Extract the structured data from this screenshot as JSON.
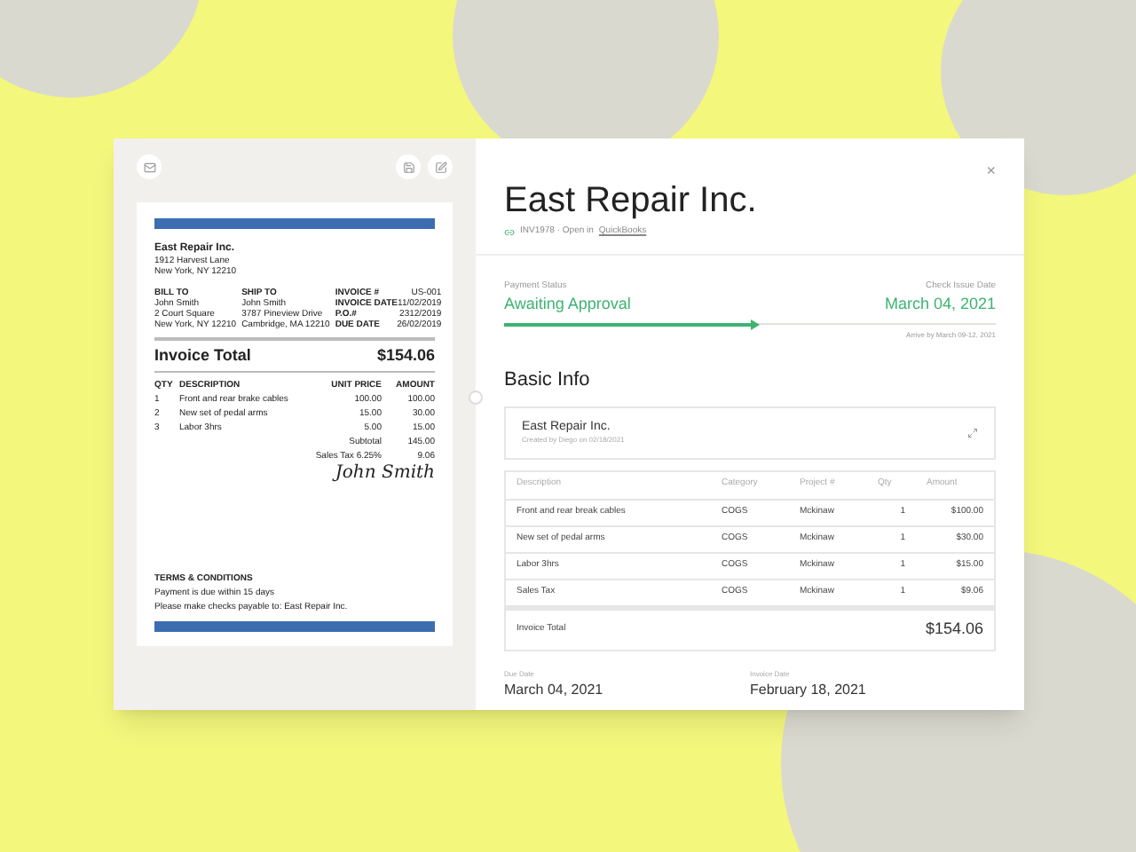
{
  "document": {
    "company": "East Repair Inc.",
    "address": [
      "1912 Harvest Lane",
      "New York, NY 12210"
    ],
    "bill_to": {
      "heading": "BILL TO",
      "lines": [
        "John Smith",
        "2 Court Square",
        "New York, NY 12210"
      ]
    },
    "ship_to": {
      "heading": "SHIP TO",
      "lines": [
        "John Smith",
        "3787 Pineview Drive",
        "Cambridge, MA 12210"
      ]
    },
    "meta": [
      {
        "label": "INVOICE #",
        "value": "US-001"
      },
      {
        "label": "INVOICE DATE",
        "value": "11/02/2019"
      },
      {
        "label": "P.O.#",
        "value": "2312/2019"
      },
      {
        "label": "DUE DATE",
        "value": "26/02/2019"
      }
    ],
    "total_label": "Invoice Total",
    "total": "$154.06",
    "columns": [
      "QTY",
      "DESCRIPTION",
      "UNIT PRICE",
      "AMOUNT"
    ],
    "items": [
      {
        "qty": "1",
        "description": "Front and rear brake cables",
        "unit_price": "100.00",
        "amount": "100.00"
      },
      {
        "qty": "2",
        "description": "New set of pedal arms",
        "unit_price": "15.00",
        "amount": "30.00"
      },
      {
        "qty": "3",
        "description": "Labor 3hrs",
        "unit_price": "5.00",
        "amount": "15.00"
      }
    ],
    "summary": [
      {
        "label": "Subtotal",
        "value": "145.00"
      },
      {
        "label": "Sales Tax 6.25%",
        "value": "9.06"
      }
    ],
    "signature": "John Smith",
    "terms_heading": "TERMS & CONDITIONS",
    "terms": [
      "Payment is due within 15 days",
      "Please make checks payable to: East Repair Inc."
    ]
  },
  "detail": {
    "close": "×",
    "title": "East Repair Inc.",
    "invoice_number": "INV1978 · Open in",
    "link": "QuickBooks",
    "payment_status_label": "Payment Status",
    "payment_status": "Awaiting Approval",
    "check_date_label": "Check Issue Date",
    "check_date": "March 04, 2021",
    "progress": {
      "level": 0.51
    },
    "arrive": "Arrive by March 09-12, 2021",
    "section": "Basic Info",
    "vendor": {
      "name": "East Repair Inc.",
      "created": "Created by Diego on 02/18/2021"
    },
    "columns": [
      "Description",
      "Category",
      "Project #",
      "Qty",
      "Amount"
    ],
    "rows": [
      [
        "Front and rear break cables",
        "COGS",
        "Mckinaw",
        "1",
        "$100.00"
      ],
      [
        "New set of pedal arms",
        "COGS",
        "Mckinaw",
        "1",
        "$30.00"
      ],
      [
        "Labor 3hrs",
        "COGS",
        "Mckinaw",
        "1",
        "$15.00"
      ],
      [
        "Sales Tax",
        "COGS",
        "Mckinaw",
        "1",
        "$9.06"
      ]
    ],
    "total_label": "Invoice Total",
    "total": "$154.06",
    "dates": [
      {
        "label": "Due Date",
        "value": "March 04, 2021"
      },
      {
        "label": "Invoice Date",
        "value": "February 18, 2021"
      }
    ]
  }
}
